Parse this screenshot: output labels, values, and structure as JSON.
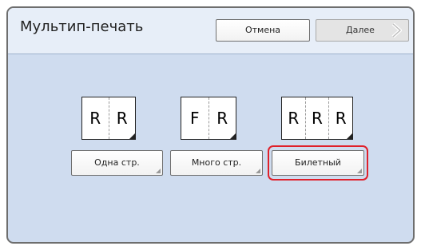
{
  "header": {
    "title": "Мультип-печать",
    "cancel_label": "Отмена",
    "next_label": "Далее"
  },
  "options": [
    {
      "id": "one-page",
      "label": "Одна стр.",
      "letters": [
        "R",
        "R"
      ],
      "selected": false
    },
    {
      "id": "multi-page",
      "label": "Много стр.",
      "letters": [
        "F",
        "R"
      ],
      "selected": false
    },
    {
      "id": "ticket",
      "label": "Билетный",
      "letters": [
        "R",
        "R",
        "R"
      ],
      "selected": true
    }
  ],
  "colors": {
    "panel_bg": "#cfdcef",
    "header_bg": "#e7eef8",
    "selection": "#e0202a"
  },
  "icons": {
    "next": "chevron-right-icon",
    "fold": "page-fold-icon"
  }
}
